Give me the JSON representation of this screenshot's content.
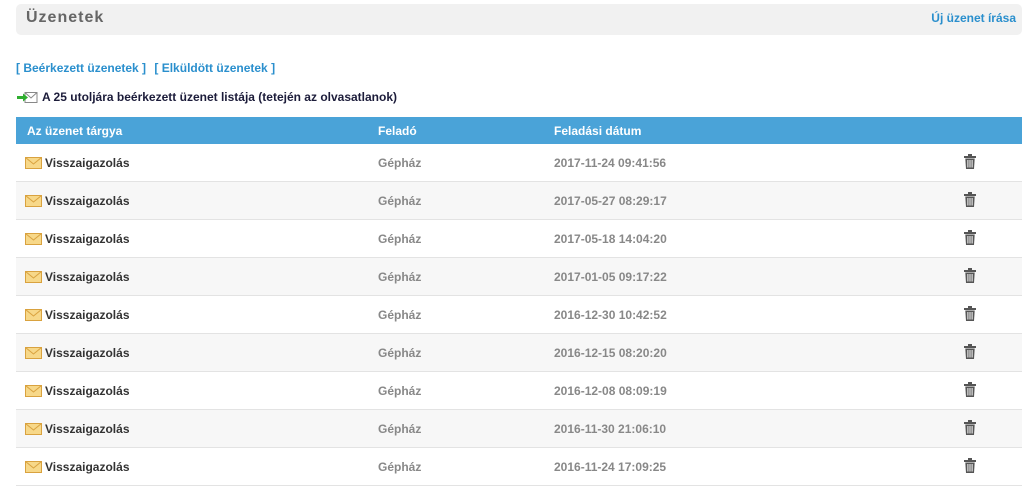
{
  "header": {
    "title": "Üzenetek",
    "new_message_label": "Új üzenet írása"
  },
  "folders": {
    "inbox_label": "[ Beérkezett üzenetek ]",
    "sent_label": "[ Elküldött üzenetek ]"
  },
  "list": {
    "caption": "A 25 utoljára beérkezett üzenet listája (tetején az olvasatlanok)",
    "columns": {
      "subject": "Az üzenet tárgya",
      "sender": "Feladó",
      "date": "Feladási dátum"
    },
    "rows": [
      {
        "subject": "Visszaigazolás",
        "sender": "Gépház",
        "date": "2017-11-24 09:41:56"
      },
      {
        "subject": "Visszaigazolás",
        "sender": "Gépház",
        "date": "2017-05-27 08:29:17"
      },
      {
        "subject": "Visszaigazolás",
        "sender": "Gépház",
        "date": "2017-05-18 14:04:20"
      },
      {
        "subject": "Visszaigazolás",
        "sender": "Gépház",
        "date": "2017-01-05 09:17:22"
      },
      {
        "subject": "Visszaigazolás",
        "sender": "Gépház",
        "date": "2016-12-30 10:42:52"
      },
      {
        "subject": "Visszaigazolás",
        "sender": "Gépház",
        "date": "2016-12-15 08:20:20"
      },
      {
        "subject": "Visszaigazolás",
        "sender": "Gépház",
        "date": "2016-12-08 08:09:19"
      },
      {
        "subject": "Visszaigazolás",
        "sender": "Gépház",
        "date": "2016-11-30 21:06:10"
      },
      {
        "subject": "Visszaigazolás",
        "sender": "Gépház",
        "date": "2016-11-24 17:09:25"
      }
    ]
  },
  "icons": {
    "message": "envelope-icon",
    "delete": "trash-icon",
    "caption": "incoming-mail-icon"
  },
  "colors": {
    "accent": "#2a8fcd",
    "table_header": "#4aa3d8",
    "envelope": "#f2c56b"
  }
}
